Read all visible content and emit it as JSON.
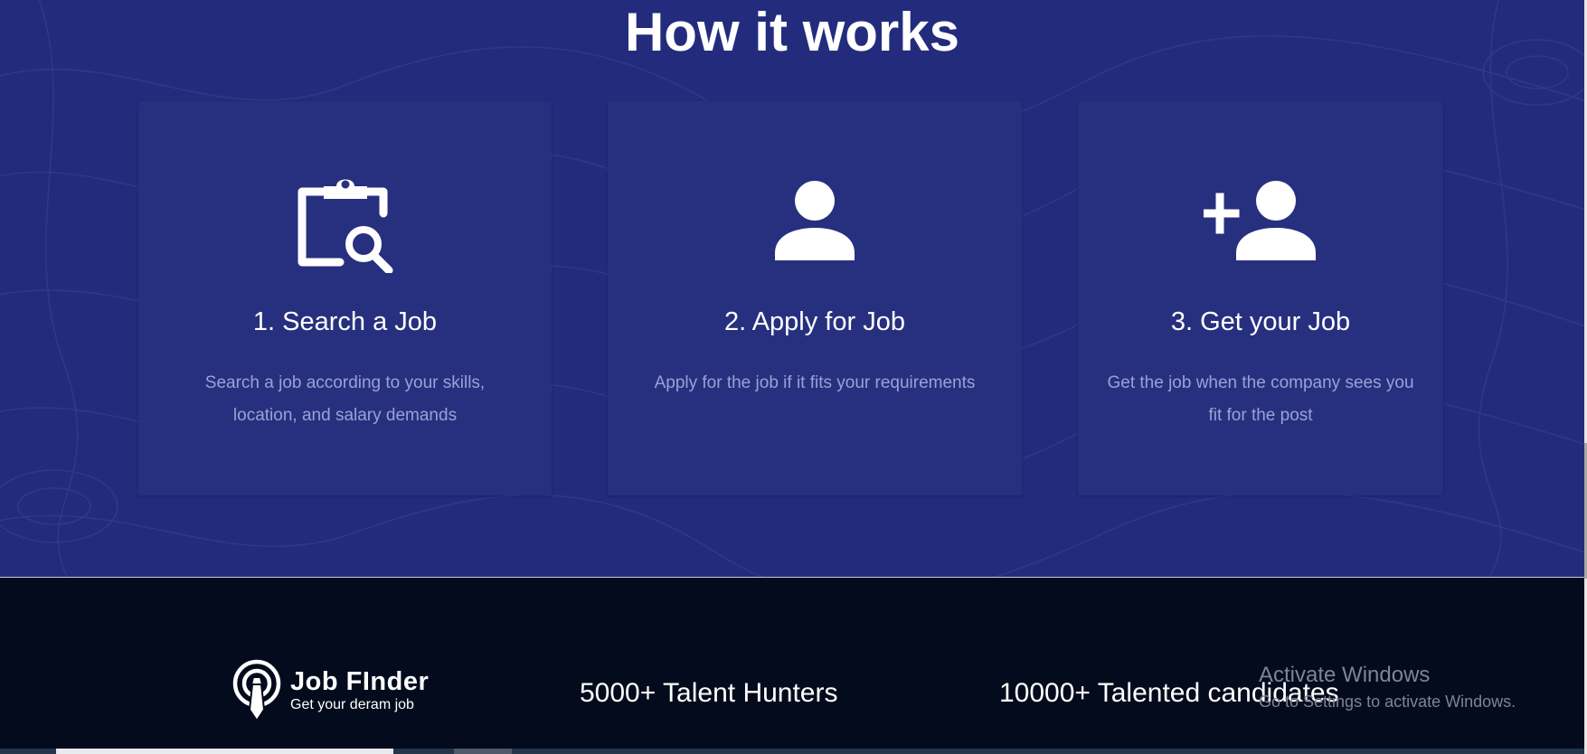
{
  "how_it_works": {
    "title": "How it works",
    "steps": [
      {
        "icon": "clipboard-search-icon",
        "title": "1. Search a Job",
        "description": "Search a job according to your skills, location, and salary demands"
      },
      {
        "icon": "user-icon",
        "title": "2. Apply for Job",
        "description": "Apply for the job if it fits your requirements"
      },
      {
        "icon": "add-user-icon",
        "title": "3. Get your Job",
        "description": "Get the job when the company sees you fit for the post"
      }
    ]
  },
  "footer": {
    "logo": {
      "icon": "tie-badge-icon",
      "name": "Job FInder",
      "tagline": "Get your deram job"
    },
    "stats": [
      "5000+ Talent Hunters",
      "10000+ Talented candidates"
    ]
  },
  "watermark": {
    "title": "Activate Windows",
    "subtitle": "Go to Settings to activate Windows."
  },
  "colors": {
    "section_background": "#232c7c",
    "card_background": "#27307f",
    "footer_background": "#040b1d",
    "heading_text": "#ffffff",
    "muted_text": "#9aa1d4"
  }
}
